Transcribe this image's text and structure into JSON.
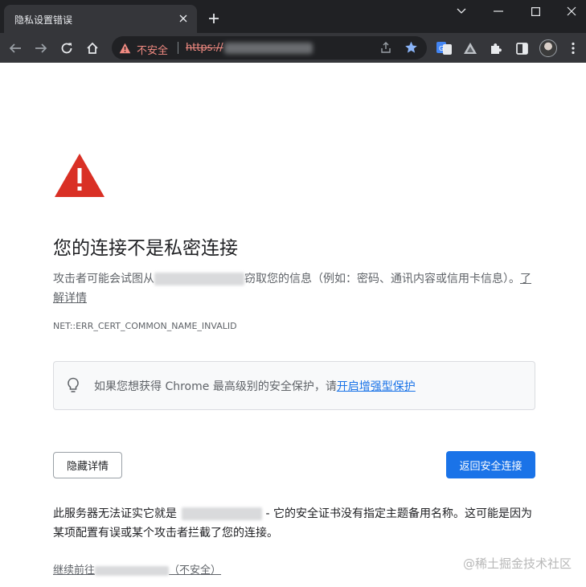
{
  "tab": {
    "title": "隐私设置错误"
  },
  "toolbar": {
    "security_label": "不安全",
    "url_scheme": "https://"
  },
  "icons": {
    "tab_close": "close-icon",
    "new_tab": "plus-icon",
    "minimize": "minimize-icon",
    "maximize": "maximize-icon",
    "close_window": "close-icon",
    "back": "arrow-left-icon",
    "forward": "arrow-right-icon",
    "reload": "reload-icon",
    "home": "home-icon",
    "warning": "warning-triangle-icon",
    "share": "share-icon",
    "bookmark": "star-icon",
    "translate": "translate-icon",
    "extension_a": "triangle-logo-icon",
    "extensions": "puzzle-icon",
    "side_panel": "side-panel-icon",
    "tip": "lightbulb-icon"
  },
  "colors": {
    "tabstrip_bg": "#202124",
    "toolbar_bg": "#35363a",
    "danger": "#d93025",
    "primary_button": "#1a73e8",
    "link": "#1a73e8"
  },
  "page": {
    "heading": "您的连接不是私密连接",
    "para_before": "攻击者可能会试图从",
    "para_after": "窃取您的信息（例如：密码、通讯内容或信用卡信息）。",
    "learn_more": "了解详情",
    "error_code": "NET::ERR_CERT_COMMON_NAME_INVALID",
    "tip_text": "如果您想获得 Chrome 最高级别的安全保护，请",
    "tip_link": "开启增强型保护",
    "hide_details_button": "隐藏详情",
    "back_button": "返回安全连接",
    "details_before": "此服务器无法证实它就是",
    "details_after": " - 它的安全证书没有指定主题备用名称。这可能是因为某项配置有误或某个攻击者拦截了您的连接。",
    "proceed_before": "继续前往",
    "proceed_after": "（不安全）"
  },
  "watermark": "@稀土掘金技术社区"
}
